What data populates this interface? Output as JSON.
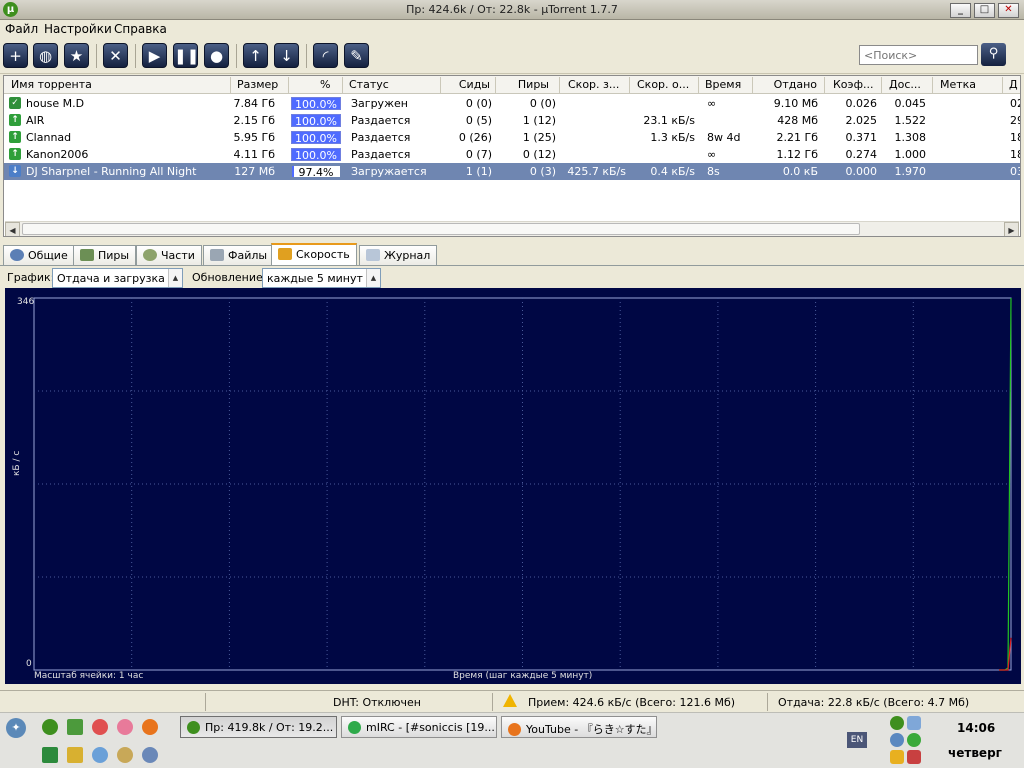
{
  "window": {
    "title": "Пр: 424.6k / От: 22.8k - µTorrent 1.7.7",
    "minimize": "_",
    "maximize": "□",
    "close": "✕"
  },
  "menu": [
    "Файл",
    "Настройки",
    "Справка"
  ],
  "toolbar": {
    "search_placeholder": "<Поиск>",
    "search_icon": "magnifier-icon"
  },
  "columns": [
    "Имя торрента",
    "Размер",
    "%",
    "Статус",
    "Сиды",
    "Пиры",
    "Скор. з...",
    "Скор. о...",
    "Время",
    "Отдано",
    "Коэф...",
    "Дос...",
    "Метка",
    "Д"
  ],
  "torrents": [
    {
      "name": "house M.D",
      "size": "7.84 Гб",
      "pct": "100.0%",
      "progress": 1.0,
      "status": "Загружен",
      "seeds": "0 (0)",
      "peers": "0 (0)",
      "down": "",
      "up": "",
      "eta": "∞",
      "uploaded": "9.10 Мб",
      "ratio": "0.026",
      "avail": "0.045",
      "label": "",
      "added": "02."
    },
    {
      "name": "AIR",
      "size": "2.15 Гб",
      "pct": "100.0%",
      "progress": 1.0,
      "status": "Раздается",
      "seeds": "0 (5)",
      "peers": "1 (12)",
      "down": "",
      "up": "23.1 кБ/s",
      "eta": "",
      "uploaded": "428 Мб",
      "ratio": "2.025",
      "avail": "1.522",
      "label": "",
      "added": "29."
    },
    {
      "name": "Clannad",
      "size": "5.95 Гб",
      "pct": "100.0%",
      "progress": 1.0,
      "status": "Раздается",
      "seeds": "0 (26)",
      "peers": "1 (25)",
      "down": "",
      "up": "1.3 кБ/s",
      "eta": "8w 4d",
      "uploaded": "2.21 Гб",
      "ratio": "0.371",
      "avail": "1.308",
      "label": "",
      "added": "18."
    },
    {
      "name": "Kanon2006",
      "size": "4.11 Гб",
      "pct": "100.0%",
      "progress": 1.0,
      "status": "Раздается",
      "seeds": "0 (7)",
      "peers": "0 (12)",
      "down": "",
      "up": "",
      "eta": "∞",
      "uploaded": "1.12 Гб",
      "ratio": "0.274",
      "avail": "1.000",
      "label": "",
      "added": "18."
    },
    {
      "name": "DJ Sharpnel - Running All Night",
      "size": "127 Мб",
      "pct": "97.4%",
      "progress": 0.974,
      "status": "Загружается",
      "seeds": "1 (1)",
      "peers": "0 (3)",
      "down": "425.7 кБ/s",
      "up": "0.4 кБ/s",
      "eta": "8s",
      "uploaded": "0.0 кБ",
      "ratio": "0.000",
      "avail": "1.970",
      "label": "",
      "added": "03."
    }
  ],
  "tabs": [
    "Общие",
    "Пиры",
    "Части",
    "Файлы",
    "Скорость",
    "Журнал"
  ],
  "speed_panel": {
    "graph_label": "График:",
    "graph_value": "Отдача и загрузка",
    "update_label": "Обновление:",
    "update_value": "каждые 5 минут",
    "y_top": "346",
    "y_bottom": "0",
    "y_unit": "кБ / с",
    "cell_scale": "Масштаб ячейки: 1 час",
    "time_axis": "Время (шаг каждые 5 минут)",
    "colors": {
      "background": "#000744",
      "grid": "#4a5a9a",
      "upload": "#22c322",
      "download": "#e02020"
    }
  },
  "chart_data": {
    "type": "line",
    "title": "",
    "xlabel": "Время (шаг каждые 5 минут)",
    "ylabel": "кБ / с",
    "ylim": [
      0,
      346
    ],
    "x": [
      0,
      1,
      2,
      3,
      4
    ],
    "series": [
      {
        "values": [
          0,
          0,
          0,
          2,
          346
        ]
      },
      {
        "values": [
          0,
          0,
          0,
          0,
          30
        ]
      }
    ]
  },
  "status": {
    "dht": "DHT: Отключен",
    "download": "Прием: 424.6 кБ/с (Всего: 121.6 Мб)",
    "upload": "Отдача: 22.8 кБ/с (Всего: 4.7 Мб)"
  },
  "taskbar": {
    "tasks": [
      "Пр: 419.8k / От: 19.2...",
      "mIRC - [#soniccis [19...",
      "YouTube - 『らき☆すた』..."
    ],
    "lang": "EN",
    "time": "14:06",
    "day": "четверг"
  }
}
